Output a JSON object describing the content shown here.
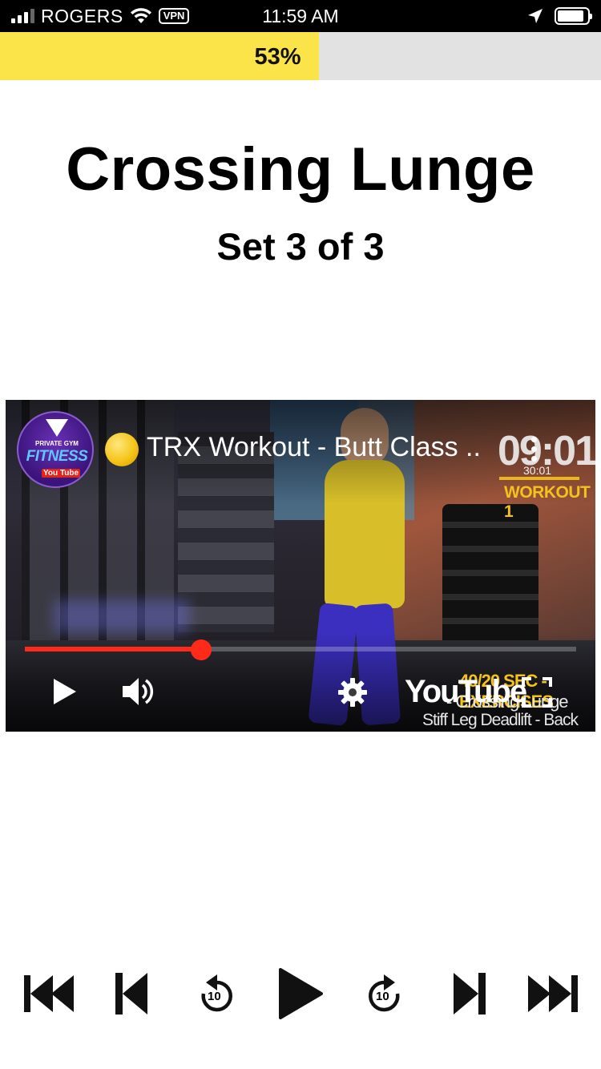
{
  "status_bar": {
    "carrier": "ROGERS",
    "vpn": "VPN",
    "time": "11:59 AM",
    "battery_level": 0.9,
    "signal_bars": 3
  },
  "progress": {
    "percent": 53,
    "label": "53%",
    "fill_color": "#fbe34a",
    "track_color": "#e2e2e2"
  },
  "exercise": {
    "title": "Crossing Lunge",
    "set_label": "Set 3 of 3"
  },
  "video": {
    "channel_logo": {
      "small_text": "PRIVATE GYM",
      "main_text": "FITNESS",
      "badge_text": "You Tube"
    },
    "title": "TRX Workout - Butt Class ...",
    "timer_big": "09:01",
    "timer_small": "30:01",
    "workout_label": "WORKOUT 1",
    "overlay_line1": "40/20 SEC - EXERCISES",
    "overlay_line2": "- Crossing Lunge",
    "overlay_line3": "Stiff Leg Deadlift - Back Lunge",
    "youtube_label": "YouTube",
    "playback_progress": 0.32,
    "accent_color": "#ff2a1a"
  },
  "controls": {
    "rewind_10": "10",
    "forward_10": "10",
    "icons": [
      "skip-to-start-icon",
      "previous-icon",
      "rewind-10-icon",
      "play-icon",
      "forward-10-icon",
      "next-icon",
      "skip-to-end-icon"
    ]
  }
}
